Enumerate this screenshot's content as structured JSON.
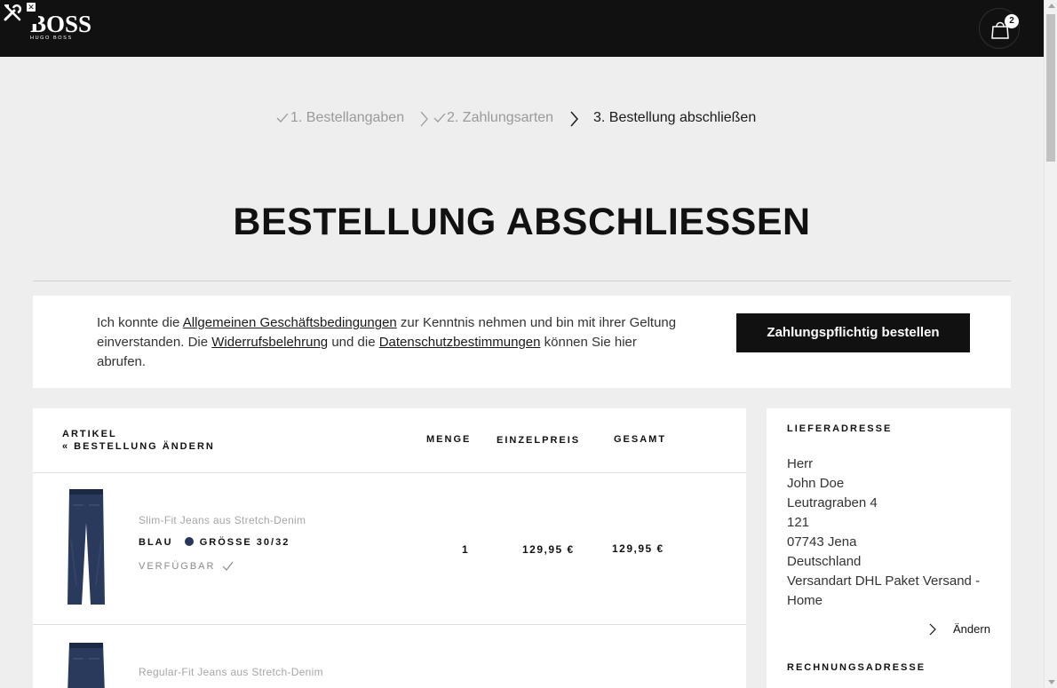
{
  "header": {
    "logo_main": "BOSS",
    "logo_sub": "HUGO BOSS",
    "cart_count": "2"
  },
  "steps": [
    {
      "label": "1. Bestellangaben",
      "state": "done"
    },
    {
      "label": "2. Zahlungsarten",
      "state": "done"
    },
    {
      "label": "3. Bestellung abschließen",
      "state": "active"
    }
  ],
  "page_title": "BESTELLUNG ABSCHLIESSEN",
  "agreement": {
    "text_1": "Ich konnte die ",
    "link_agb": "Allgemeinen Geschäftsbedingungen",
    "text_2": " zur Kenntnis nehmen und bin mit ihrer Geltung einverstanden. Die ",
    "link_widerruf": "Widerrufsbelehrung",
    "text_3": " und die ",
    "link_datenschutz": "Datenschutzbestimmungen",
    "text_4": " können Sie hier abrufen.",
    "button": "Zahlungspflichtig bestellen"
  },
  "cart": {
    "col_article": "ARTIKEL",
    "edit_order": "« BESTELLUNG ÄNDERN",
    "col_qty": "MENGE",
    "col_unit_price": "EINZELPREIS",
    "col_total": "GESAMT",
    "items": [
      {
        "name": "Slim-Fit Jeans aus Stretch-Denim",
        "color": "BLAU",
        "size": "GRÖSSE 30/32",
        "availability": "VERFÜGBAR",
        "qty": "1",
        "unit_price": "129,95 €",
        "total": "129,95 €"
      },
      {
        "name": "Regular-Fit Jeans aus Stretch-Denim"
      }
    ]
  },
  "shipping": {
    "heading": "LIEFERADRESSE",
    "lines": [
      "Herr",
      "John Doe",
      "Leutragraben 4",
      "121",
      "07743 Jena",
      "Deutschland",
      "Versandart DHL Paket Versand - Home"
    ],
    "edit": "Ändern"
  },
  "billing": {
    "heading": "RECHNUNGSADRESSE"
  },
  "colors": {
    "header_bg": "#111111",
    "page_bg": "#eeeeee",
    "denim": "#27365a"
  }
}
